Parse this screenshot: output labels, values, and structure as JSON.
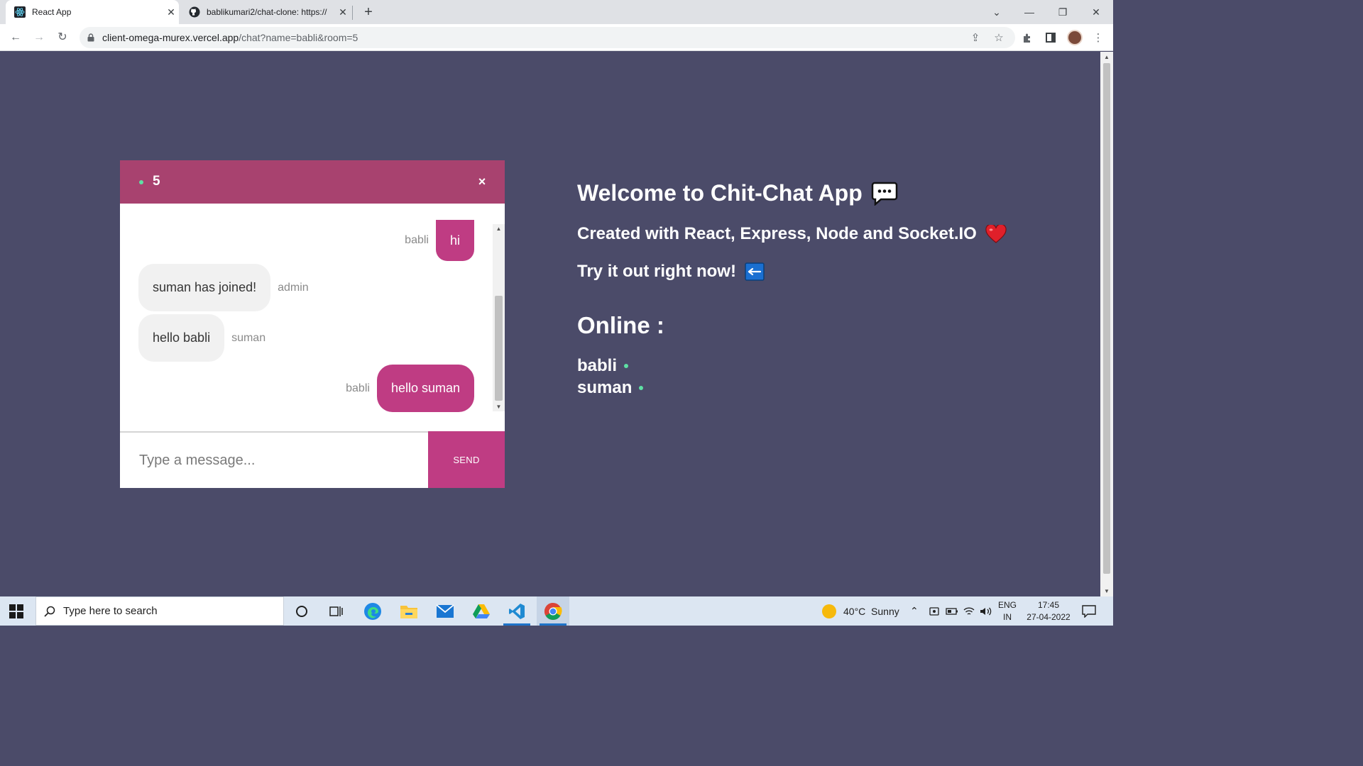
{
  "browser": {
    "tabs": [
      {
        "title": "React App",
        "icon": "react-icon",
        "active": true
      },
      {
        "title": "bablikumari2/chat-clone: https://",
        "icon": "github-icon",
        "active": false
      }
    ],
    "new_tab": "+",
    "url_host": "client-omega-murex.vercel.app",
    "url_path": "/chat?name=babli&room=5"
  },
  "chat": {
    "room": "5",
    "close": "×",
    "messages": [
      {
        "text": "hi",
        "sender": "babli",
        "mine": true
      },
      {
        "text": "suman has joined!",
        "sender": "admin",
        "mine": false
      },
      {
        "text": "hello babli",
        "sender": "suman",
        "mine": false
      },
      {
        "text": "hello suman",
        "sender": "babli",
        "mine": true
      }
    ],
    "input_placeholder": "Type a message...",
    "send_label": "SEND",
    "colors": {
      "header": "#a8426f",
      "mine_bubble": "#bf3c83",
      "theirs_bubble": "#f1f1f1",
      "online": "#5ee0a4"
    }
  },
  "info": {
    "welcome": "Welcome to Chit-Chat App",
    "created": "Created with React, Express, Node and Socket.IO",
    "try": "Try it out right now!",
    "online_title": "Online :",
    "users": [
      "babli",
      "suman"
    ]
  },
  "taskbar": {
    "search_placeholder": "Type here to search",
    "weather": "40°C  Sunny",
    "lang_top": "ENG",
    "lang_bottom": "IN",
    "time": "17:45",
    "date": "27-04-2022"
  },
  "page": {
    "background": "#4b4b69"
  }
}
